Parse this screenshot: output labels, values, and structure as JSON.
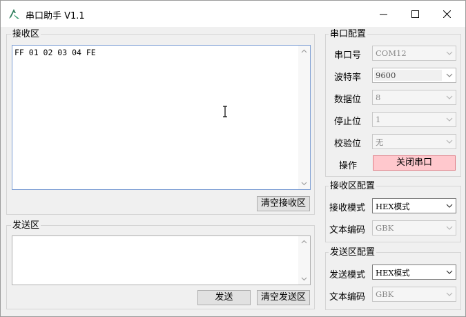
{
  "window": {
    "title": "串口助手 V1.1"
  },
  "receive": {
    "group_label": "接收区",
    "content": "FF 01 02 03 04 FE",
    "clear_label": "清空接收区"
  },
  "send": {
    "group_label": "发送区",
    "content": "",
    "send_label": "发送",
    "clear_label": "清空发送区"
  },
  "serial_config": {
    "group_label": "串口配置",
    "port_label": "串口号",
    "port_value": "COM12",
    "baud_label": "波特率",
    "baud_value": "9600",
    "data_bits_label": "数据位",
    "data_bits_value": "8",
    "stop_bits_label": "停止位",
    "stop_bits_value": "1",
    "parity_label": "校验位",
    "parity_value": "无",
    "action_label": "操作",
    "action_button": "关闭串口"
  },
  "receive_config": {
    "group_label": "接收区配置",
    "mode_label": "接收模式",
    "mode_value": "HEX模式",
    "encoding_label": "文本编码",
    "encoding_value": "GBK"
  },
  "send_config": {
    "group_label": "发送区配置",
    "mode_label": "发送模式",
    "mode_value": "HEX模式",
    "encoding_label": "文本编码",
    "encoding_value": "GBK"
  },
  "colors": {
    "close_port_bg": "#ffc8cd",
    "focus_border": "#7a9cd3"
  }
}
